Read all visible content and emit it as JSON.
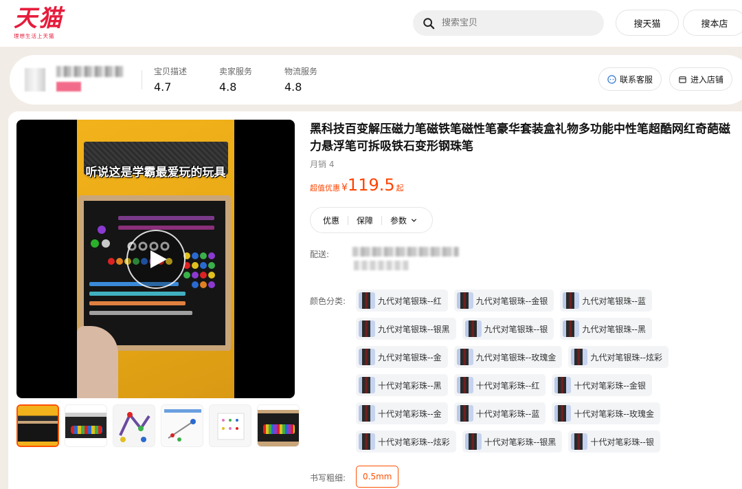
{
  "header": {
    "logo_text": "天猫",
    "logo_slogan": "理想生活上天猫",
    "search_placeholder": "搜索宝贝",
    "btn_search_tmall": "搜天猫",
    "btn_search_shop": "搜本店"
  },
  "shop": {
    "scores": [
      {
        "label": "宝贝描述",
        "value": "4.7"
      },
      {
        "label": "卖家服务",
        "value": "4.8"
      },
      {
        "label": "物流服务",
        "value": "4.8"
      }
    ],
    "btn_contact": "联系客服",
    "btn_enter_shop": "进入店铺"
  },
  "product": {
    "video_caption": "听说这是学霸最爱玩的玩具",
    "title": "黑科技百变解压磁力笔磁铁笔磁性笔豪华套装盒礼物多功能中性笔超酷网红奇葩磁力悬浮笔可拆吸铁石变形钢珠笔",
    "sales": "月销 4",
    "price_label": "超值优惠",
    "currency": "¥",
    "price": "119.5",
    "price_suffix": "起",
    "tabs": [
      "优惠",
      "保障",
      "参数"
    ],
    "delivery_label": "配送:",
    "color_label": "颜色分类:",
    "size_label": "书写粗细:",
    "size_value": "0.5mm",
    "color_options": [
      [
        "九代对笔银珠--红",
        "九代对笔银珠--金银",
        "九代对笔银珠--蓝"
      ],
      [
        "九代对笔银珠--银黑",
        "九代对笔银珠--银",
        "九代对笔银珠--黑"
      ],
      [
        "九代对笔银珠--金",
        "九代对笔银珠--玫瑰金",
        "九代对笔银珠--炫彩"
      ],
      [
        "十代对笔彩珠--黑",
        "十代对笔彩珠--红",
        "十代对笔彩珠--金银"
      ],
      [
        "十代对笔彩珠--金",
        "十代对笔彩珠--蓝",
        "十代对笔彩珠--玫瑰金"
      ],
      [
        "十代对笔彩珠--炫彩",
        "十代对笔彩珠--银黑",
        "十代对笔彩珠--银"
      ]
    ]
  },
  "colors": {
    "brand": "#e61c3c",
    "price": "#ff4400",
    "selected": "#ff5000"
  }
}
